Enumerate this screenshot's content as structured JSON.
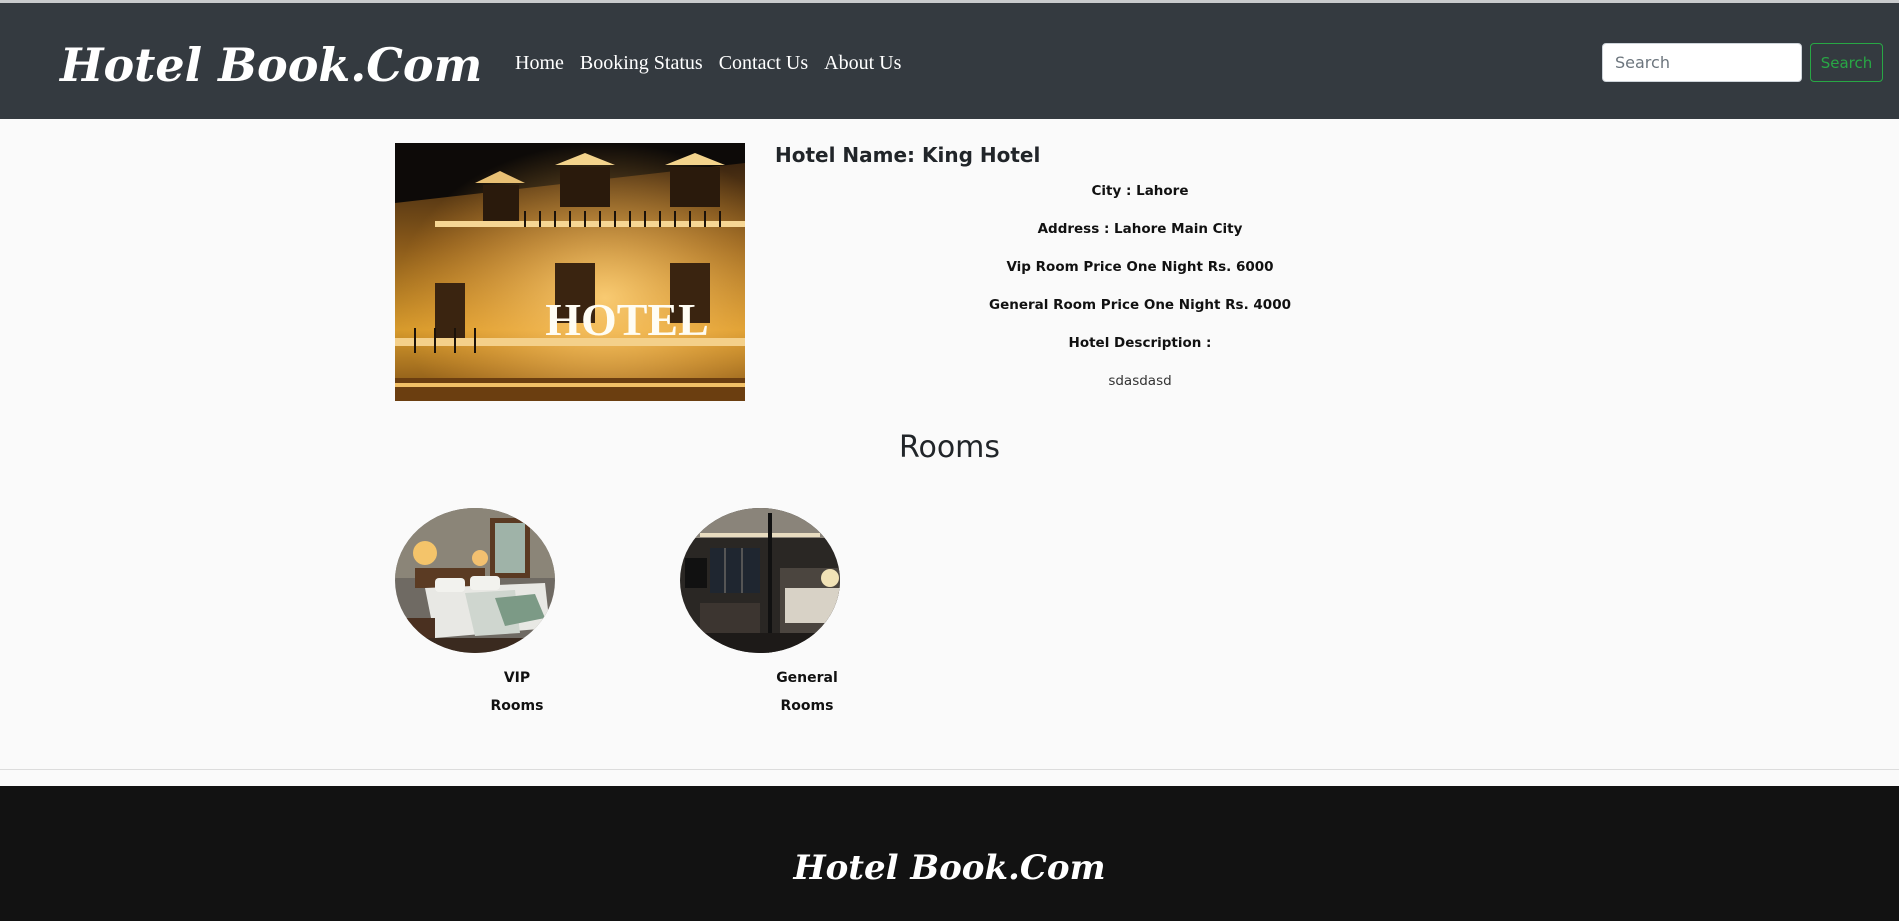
{
  "header": {
    "brand": "Hotel Book.Com",
    "nav": [
      "Home",
      "Booking Status",
      "Contact Us",
      "About Us"
    ],
    "search": {
      "placeholder": "Search",
      "button_label": "Search"
    }
  },
  "hotel": {
    "name": "Hotel Name: King Hotel",
    "image_sign": "HOTEL",
    "details": [
      "City : Lahore",
      "Address : Lahore Main City",
      "Vip Room Price One Night Rs. 6000",
      "General Room Price One Night Rs. 4000",
      "Hotel Description :"
    ],
    "description": "sdasdasd"
  },
  "rooms": {
    "title": "Rooms",
    "items": [
      {
        "line1": "VIP",
        "line2": "Rooms"
      },
      {
        "line1": "General",
        "line2": "Rooms"
      }
    ]
  },
  "footer": {
    "brand": "Hotel Book.Com"
  },
  "colors": {
    "navbar": "#343a40",
    "footer": "#121212",
    "accent_green": "#28a745"
  }
}
